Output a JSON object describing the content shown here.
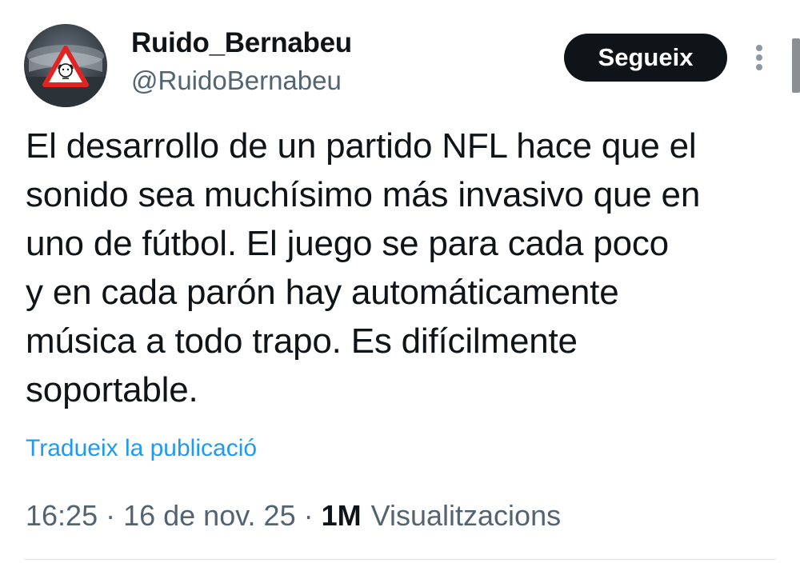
{
  "author": {
    "display_name": "Ruido_Bernabeu",
    "handle": "@RuidoBernabeu",
    "avatar_icon": "warning-sign-avatar-icon"
  },
  "follow_button": {
    "label": "Segueix"
  },
  "more_menu": {
    "icon": "more-vertical-icon"
  },
  "tweet": {
    "lines": [
      "El desarrollo de un partido NFL hace que el",
      "sonido sea muchísimo más invasivo que en",
      "uno de fútbol. El juego se para cada poco",
      "y en cada parón hay automáticamente",
      "música a todo trapo. Es difícilmente",
      "soportable."
    ]
  },
  "translate_link": "Tradueix la publicació",
  "meta": {
    "time": "16:25",
    "separator": "·",
    "date": "16 de nov. 25",
    "views_count": "1M",
    "views_label": "Visualitzacions"
  },
  "colors": {
    "button_bg": "#0f1419",
    "link": "#1d9bf0",
    "secondary_text": "#536471",
    "primary_text": "#0f1419"
  }
}
